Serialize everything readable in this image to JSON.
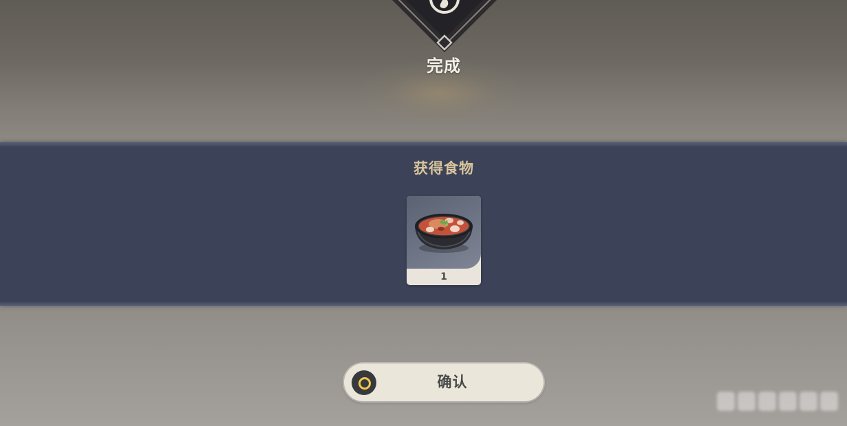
{
  "header": {
    "status_label": "完成",
    "emblem_icon": "completion-emblem-icon"
  },
  "reward_panel": {
    "title": "获得食物",
    "items": [
      {
        "icon": "food-stew-bowl-icon",
        "count": "1"
      }
    ]
  },
  "actions": {
    "confirm_label": "确认",
    "confirm_icon": "controller-circle-button-icon"
  },
  "colors": {
    "band_background": "#3c4257",
    "band_title": "#d9c49c",
    "button_background": "#ebe6da",
    "button_icon_ring": "#f1c84a"
  }
}
